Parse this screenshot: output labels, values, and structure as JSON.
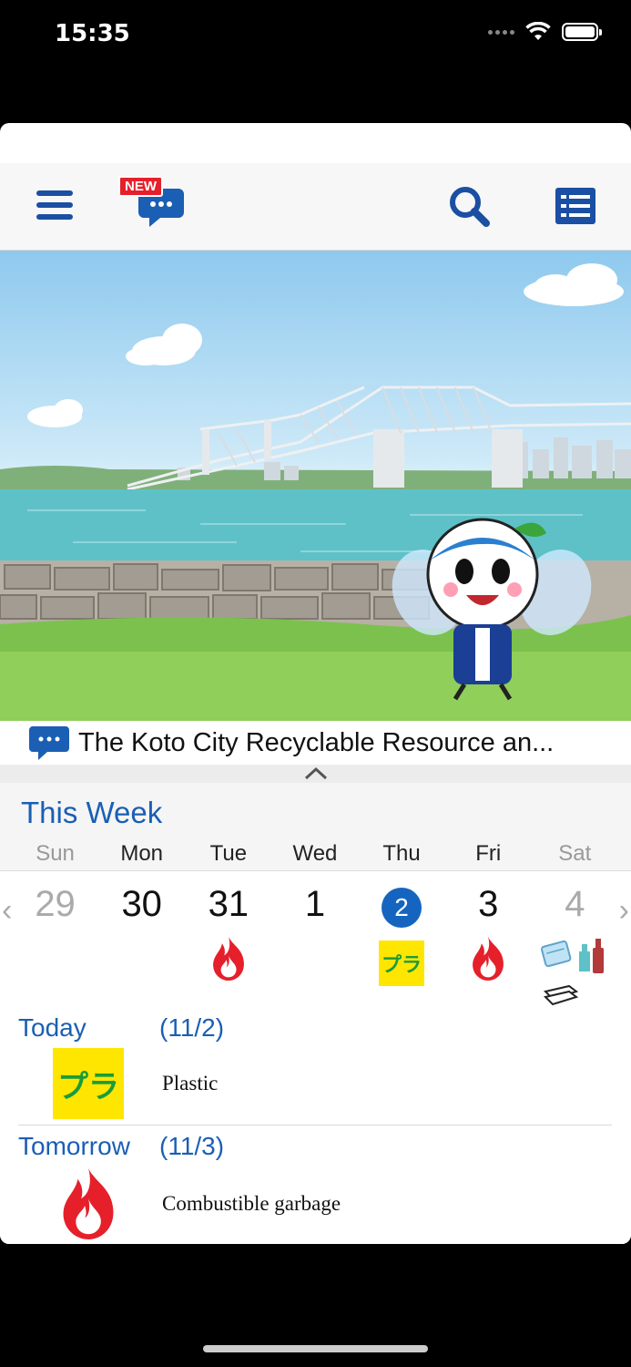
{
  "status": {
    "time": "15:35"
  },
  "toolbar": {
    "new_badge": "NEW"
  },
  "news": {
    "text": "The Koto City Recyclable Resource an..."
  },
  "week": {
    "title": "This Week",
    "days": [
      "Sun",
      "Mon",
      "Tue",
      "Wed",
      "Thu",
      "Fri",
      "Sat"
    ],
    "dates": [
      "29",
      "30",
      "31",
      "1",
      "2",
      "3",
      "4"
    ],
    "today_index": 4,
    "icons": [
      "",
      "",
      "fire-icon",
      "",
      "plastic-icon",
      "fire-icon",
      "recyclables-icon"
    ],
    "pla_label": "プラ"
  },
  "schedule": {
    "today": {
      "label": "Today",
      "date": "(11/2)",
      "item": "Plastic"
    },
    "tomorrow": {
      "label": "Tomorrow",
      "date": "(11/3)",
      "item": "Combustible garbage"
    }
  },
  "colors": {
    "accent": "#1a5fb4",
    "fire": "#e5202a",
    "plastic_bg": "#ffe600",
    "plastic_text": "#1a9c3a"
  }
}
